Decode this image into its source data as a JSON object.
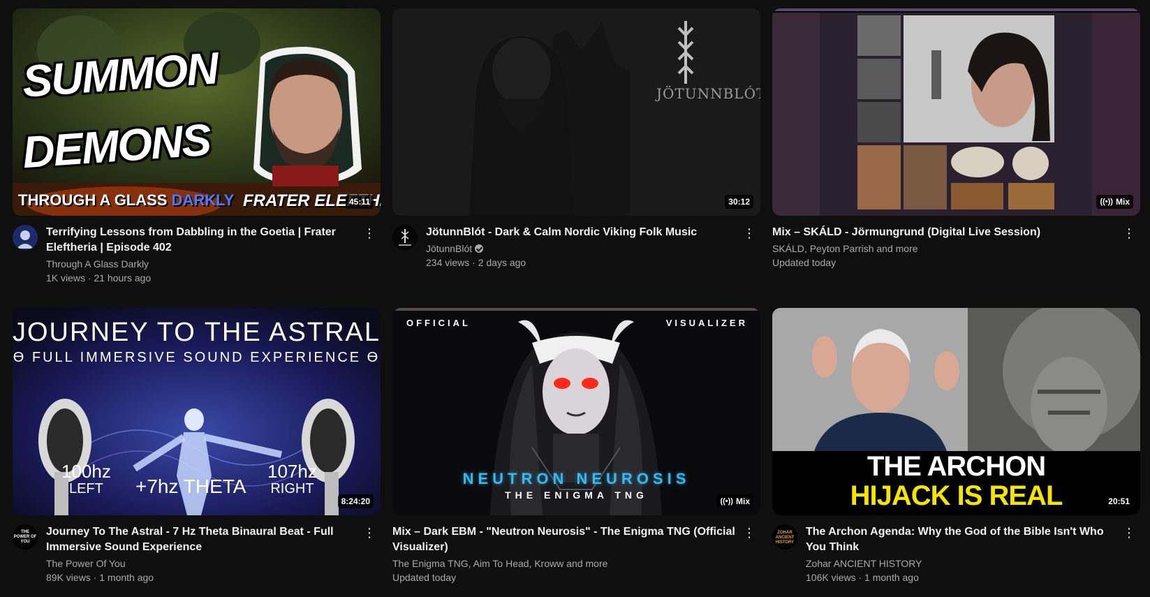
{
  "videos": [
    {
      "title": "Terrifying Lessons from Dabbling in the Goetia | Frater Eleftheria | Episode 402",
      "channel": "Through A Glass Darkly",
      "stats": "1K views · 21 hours ago",
      "duration": "45:11",
      "thumb_text": {
        "line1": "SUMMON",
        "line2": "DEMONS",
        "banner_left": "THROUGH A GLASS",
        "banner_blue": "DARKLY",
        "banner_right": "FRATER ELEFTHERIA"
      }
    },
    {
      "title": "JötunnBlót - Dark & Calm Nordic Viking Folk Music",
      "channel": "JötunnBlót",
      "stats": "234 views · 2 days ago",
      "duration": "30:12",
      "thumb_text": {
        "logo": "JÖTUNNBLÓT"
      }
    },
    {
      "title": "Mix – SKÁLD - Jörmungrund (Digital Live Session)",
      "channel": "SKÁLD, Peyton Parrish and more",
      "stats": "Updated today",
      "badge": "Mix"
    },
    {
      "title": "Journey To The Astral - 7 Hz Theta Binaural Beat - Full Immersive Sound Experience",
      "channel": "The Power Of You",
      "stats": "89K views · 1 month ago",
      "duration": "8:24:20",
      "thumb_text": {
        "line1": "JOURNEY TO THE ASTRAL",
        "line2": "ϴ FULL IMMERSIVE SOUND EXPERIENCE ϴ",
        "left_hz": "100hz",
        "left_lbl": "LEFT",
        "center": "+7hz THETA",
        "right_hz": "107hz",
        "right_lbl": "RIGHT"
      },
      "avatar_text": "THE POWER OF YOU"
    },
    {
      "title": "Mix – Dark EBM - \"Neutron Neurosis\" - The Enigma TNG (Official Visualizer)",
      "channel": "The Enigma TNG, Aim To Head, Kroww and more",
      "stats": "Updated today",
      "badge": "Mix",
      "thumb_text": {
        "official": "OFFICIAL",
        "visualizer": "VISUALIZER",
        "song": "NEUTRON NEUROSIS",
        "artist": "THE ENIGMA TNG"
      }
    },
    {
      "title": "The Archon Agenda: Why the God of the Bible Isn't Who You Think",
      "channel": "Zohar ANCIENT HISTORY",
      "stats": "106K views · 1 month ago",
      "duration": "20:51",
      "thumb_text": {
        "line1": "THE ARCHON",
        "line2": "HIJACK IS REAL"
      },
      "avatar_text": "ZOHAR ANCIENT HISTORY"
    }
  ],
  "colors": {
    "background": "#0f0f0f",
    "text": "#f1f1f1",
    "secondary": "#aaaaaa",
    "yellow": "#f5e400",
    "cyan": "#3fb6e6"
  }
}
